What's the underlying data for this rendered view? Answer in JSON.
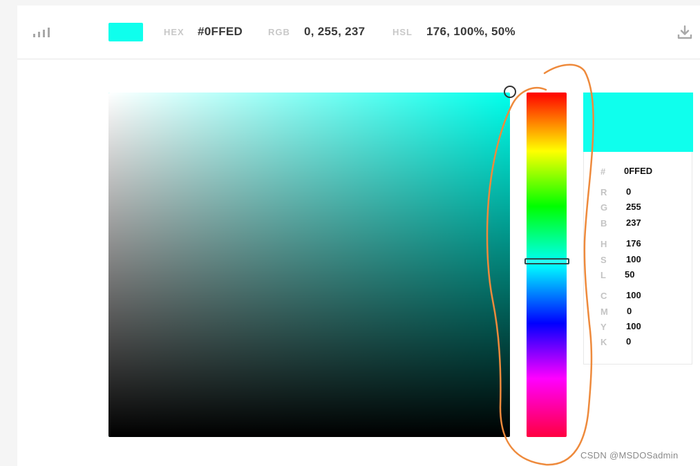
{
  "current_color": {
    "hex_color": "#0FFFED",
    "hue_color": "#00FFEB"
  },
  "header": {
    "hex_label": "HEX",
    "hex_value": "#0FFED",
    "rgb_label": "RGB",
    "rgb_value": "0, 255, 237",
    "hsl_label": "HSL",
    "hsl_value": "176, 100%, 50%"
  },
  "icons": {
    "menu": "signal-bars-icon",
    "download": "download-icon"
  },
  "picker": {
    "saturation": 100,
    "brightness": 100,
    "hue": 176
  },
  "panel": {
    "hash_label": "#",
    "hex": "0FFED",
    "r_label": "R",
    "r": "0",
    "g_label": "G",
    "g": "255",
    "b_label": "B",
    "b": "237",
    "h_label": "H",
    "h": "176",
    "s_label": "S",
    "s": "100",
    "l_label": "L",
    "l": "50",
    "c_label": "C",
    "c": "100",
    "m_label": "M",
    "m": "0",
    "y_label": "Y",
    "y": "100",
    "k_label": "K",
    "k": "0"
  },
  "annotation_color": "#EE8A3C",
  "watermark": "CSDN @MSDOSadmin"
}
